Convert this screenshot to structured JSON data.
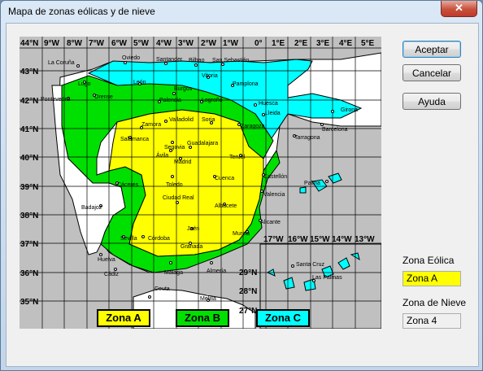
{
  "window": {
    "title": "Mapa de zonas eólicas y de nieve",
    "close_glyph": "✕"
  },
  "buttons": {
    "ok": "Aceptar",
    "cancel": "Cancelar",
    "help": "Ayuda"
  },
  "zone_eolica": {
    "label": "Zona Eólica",
    "value": "Zona  A"
  },
  "zone_nieve": {
    "label": "Zona de Nieve",
    "value": "Zona  4"
  },
  "legend": {
    "a": "Zona A",
    "b": "Zona B",
    "c": "Zona C"
  },
  "colors": {
    "zone_a": "#ffff00",
    "zone_b": "#00e000",
    "zone_c": "#00ffff",
    "grid": "#000000",
    "sea": "#c0c0c0"
  },
  "map": {
    "lon_labels": [
      "44°N",
      "9°W",
      "8°W",
      "7°W",
      "6°W",
      "5°W",
      "4°W",
      "3°W",
      "2°W",
      "1°W",
      "0°",
      "1°E",
      "2°E",
      "3°E",
      "4°E",
      "5°E"
    ],
    "lat_labels": [
      "43°N",
      "42°N",
      "41°N",
      "40°N",
      "39°N",
      "38°N",
      "37°N",
      "36°N",
      "35°N"
    ],
    "canary_lon_labels": [
      "17°W",
      "16°W",
      "15°W",
      "14°W",
      "13°W"
    ],
    "canary_lat_labels": [
      "29°N",
      "28°N",
      "27°N"
    ],
    "cities": [
      "La Coruña",
      "Oviedo",
      "Santander",
      "Bilbao",
      "San Sebastián",
      "Lugo",
      "León",
      "Vitoria",
      "Pamplona",
      "Pontevedra",
      "Orense",
      "Burgos",
      "Palencia",
      "Logroño",
      "Huesca",
      "Girona",
      "Lleida",
      "Zamora",
      "Valladolid",
      "Soria",
      "Barcelona",
      "Zaragoza",
      "Salamanca",
      "Tarragona",
      "Segovia",
      "Guadalajara",
      "Ávila",
      "Madrid",
      "Teruel",
      "Castellón",
      "Palma",
      "Cuenca",
      "Cáceres",
      "Toledo",
      "Valencia",
      "Badajoz",
      "Ciudad Real",
      "Albacete",
      "Alicante",
      "Jaén",
      "Murcia",
      "Córdoba",
      "Sevilla",
      "Granada",
      "Huelva",
      "Cádiz",
      "Málaga",
      "Almería",
      "Santa Cruz",
      "Las Palmas",
      "Ceuta",
      "Melilla"
    ]
  }
}
